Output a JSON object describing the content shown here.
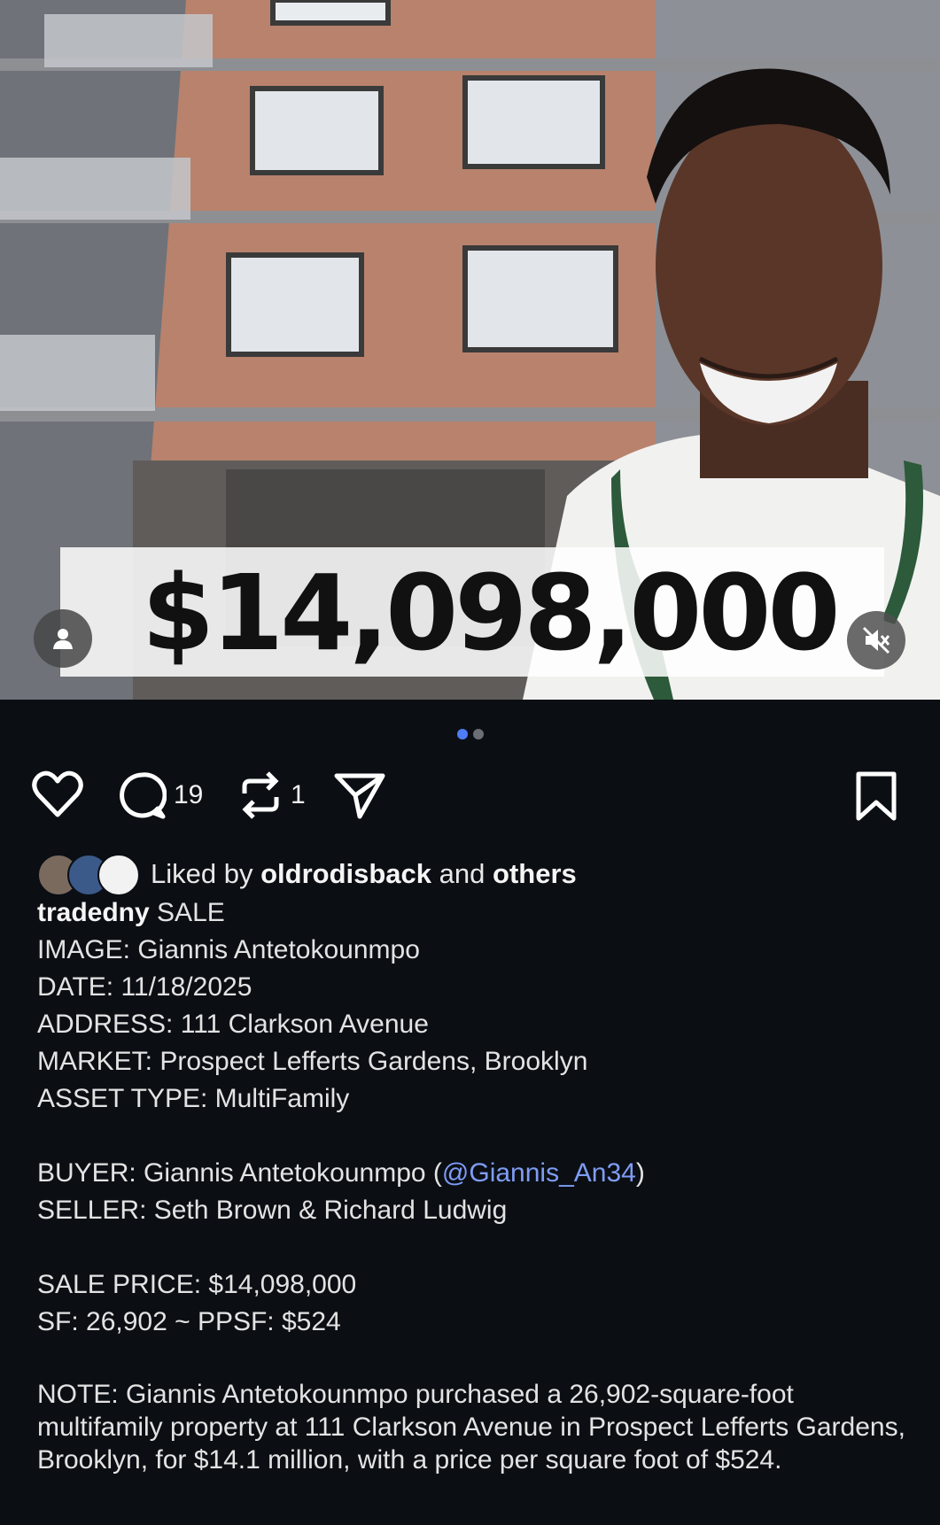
{
  "media": {
    "price_overlay": "$14,098,000",
    "carousel_count": 2,
    "carousel_active_index": 0,
    "icons": {
      "avatar": "person-icon",
      "mute": "speaker-muted-icon"
    }
  },
  "actions": {
    "like_icon": "heart-icon",
    "comment_icon": "comment-bubble-icon",
    "comment_count": "19",
    "repost_icon": "repost-icon",
    "repost_count": "1",
    "share_icon": "send-icon",
    "save_icon": "bookmark-icon"
  },
  "likes": {
    "prefix": "Liked by",
    "user": "oldrodisback",
    "middle": "and",
    "others": "others"
  },
  "post": {
    "username": "tradedny",
    "lines": {
      "sale": "SALE",
      "image": "IMAGE: Giannis Antetokounmpo",
      "date": "DATE: 11/18/2025",
      "address": "ADDRESS: 111 Clarkson Avenue",
      "market": "MARKET: Prospect Lefferts Gardens, Brooklyn",
      "asset": "ASSET TYPE: MultiFamily",
      "buyer_prefix": "BUYER: Giannis Antetokounmpo (",
      "buyer_mention": "@Giannis_An34",
      "buyer_suffix": ")",
      "seller": "SELLER: Seth Brown & Richard Ludwig",
      "sale_price": "SALE PRICE: $14,098,000",
      "sf": "SF: 26,902 ~ PPSF: $524",
      "note": "NOTE: Giannis Antetokounmpo purchased a 26,902-square-foot multifamily property at 111 Clarkson Avenue in Prospect Lefferts Gardens, Brooklyn, for $14.1 million, with a price per square foot of $524."
    }
  },
  "colors": {
    "background": "#0b0f14",
    "mention": "#7f9cf5",
    "dot_active": "#4f7cf7",
    "dot_inactive": "#6b6f75"
  }
}
